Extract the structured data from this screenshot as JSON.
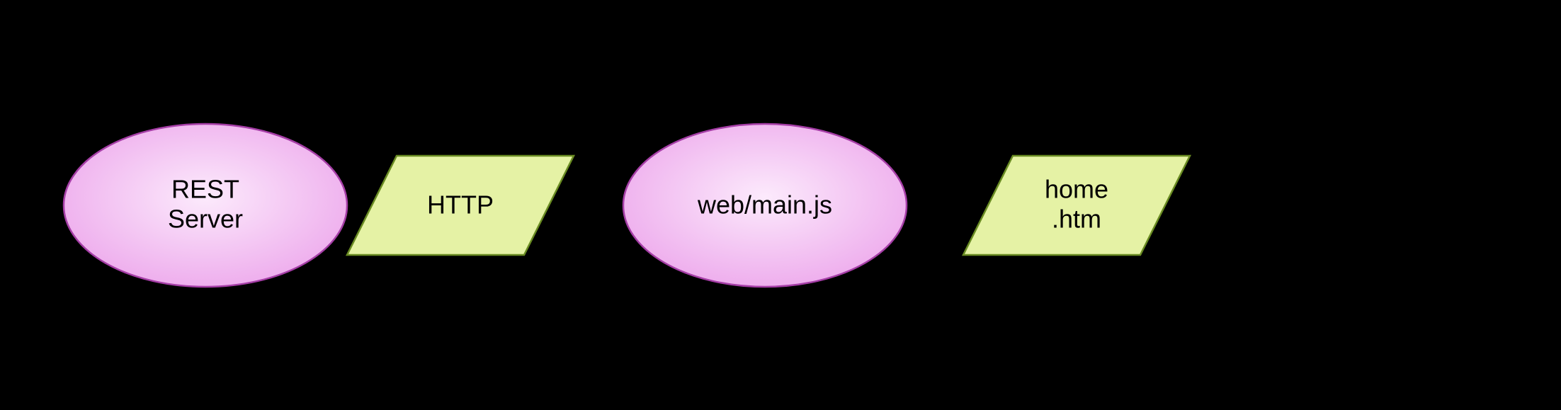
{
  "diagram": {
    "nodes": {
      "rest_server": {
        "label_line1": "REST",
        "label_line2": "Server",
        "shape": "ellipse",
        "fill": "#f0c5ef",
        "stroke": "#a63ea7"
      },
      "http": {
        "label": "HTTP",
        "shape": "parallelogram",
        "fill": "#e5f2a5",
        "stroke": "#698b22"
      },
      "mainjs": {
        "label": "web/main.js",
        "shape": "ellipse",
        "fill": "#f0c5ef",
        "stroke": "#a63ea7"
      },
      "home": {
        "label_line1": "home",
        "label_line2": ".htm",
        "shape": "parallelogram",
        "fill": "#e5f2a5",
        "stroke": "#698b22"
      }
    },
    "edges": [
      {
        "from": "rest_server",
        "to": "http"
      },
      {
        "from": "http",
        "to": "mainjs"
      },
      {
        "from": "mainjs",
        "to": "home"
      }
    ],
    "colors": {
      "ellipse_fill": "#f0c5ef",
      "ellipse_stroke": "#a63ea7",
      "parallelogram_fill": "#e5f2a5",
      "parallelogram_stroke": "#698b22",
      "edge": "#000000",
      "background": "#000000"
    }
  }
}
